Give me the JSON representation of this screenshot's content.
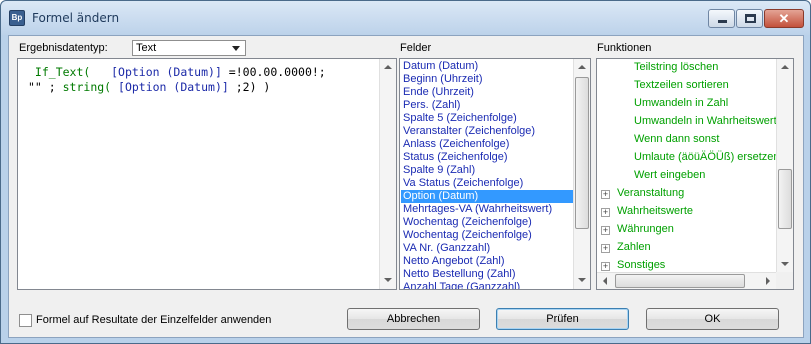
{
  "window": {
    "title": "Formel ändern",
    "app_icon_text": "Bp"
  },
  "labels": {
    "result_type": "Ergebnisdatentyp:",
    "fields": "Felder",
    "functions": "Funktionen"
  },
  "result_type_select": {
    "value": "Text"
  },
  "formula": {
    "line1": [
      {
        "text": " If_Text(",
        "cls": "kw"
      },
      {
        "text": "   ",
        "cls": "plain"
      },
      {
        "text": "[Option (Datum)]",
        "cls": "fld"
      },
      {
        "text": " =!00.00.0000!;",
        "cls": "plain"
      }
    ],
    "line2": [
      {
        "text": "\"\" ; ",
        "cls": "plain"
      },
      {
        "text": "string(",
        "cls": "kw"
      },
      {
        "text": " [Option (Datum)]",
        "cls": "fld"
      },
      {
        "text": " ;2) )",
        "cls": "plain"
      }
    ]
  },
  "fields": {
    "items": [
      "Datum (Datum)",
      "Beginn (Uhrzeit)",
      "Ende (Uhrzeit)",
      "Pers. (Zahl)",
      "Spalte 5 (Zeichenfolge)",
      "Veranstalter (Zeichenfolge)",
      "Anlass (Zeichenfolge)",
      "Status (Zeichenfolge)",
      "Spalte 9 (Zahl)",
      "Va Status (Zeichenfolge)",
      "Option (Datum)",
      "Mehrtages-VA (Wahrheitswert)",
      "Wochentag (Zeichenfolge)",
      "Wochentag (Zeichenfolge)",
      "VA Nr. (Ganzzahl)",
      "Netto Angebot (Zahl)",
      "Netto Bestellung (Zahl)",
      "Anzahl Tage (Ganzzahl)"
    ],
    "selected_index": 10
  },
  "functions": {
    "leaves": [
      "Teilstring löschen",
      "Textzeilen sortieren",
      "Umwandeln in Zahl",
      "Umwandeln in Wahrheitswert",
      "Wenn dann sonst",
      "Umlaute (äöüÄÖÜß) ersetzen",
      "Wert eingeben"
    ],
    "groups": [
      "Veranstaltung",
      "Wahrheitswerte",
      "Währungen",
      "Zahlen",
      "Sonstiges"
    ],
    "tree_toggle": "+"
  },
  "options": {
    "apply_to_fields_label": "Formel auf Resultate der Einzelfelder anwenden",
    "apply_to_fields_checked": false
  },
  "buttons": {
    "cancel": "Abbrechen",
    "check": "Prüfen",
    "ok": "OK"
  },
  "caption_buttons": {
    "close": "✕"
  }
}
